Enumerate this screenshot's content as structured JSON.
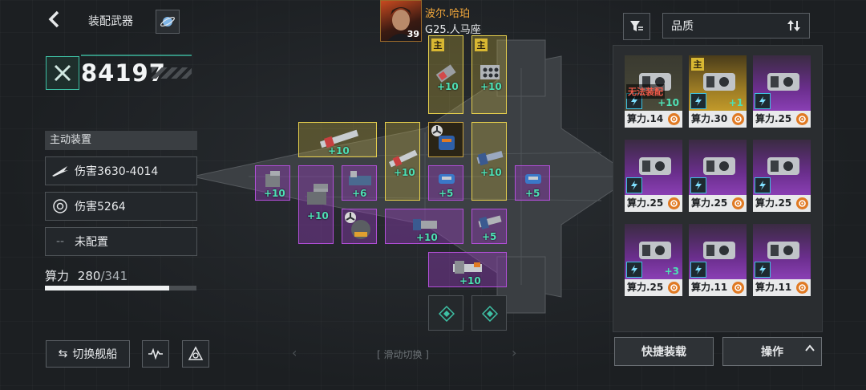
{
  "header": {
    "title": "装配武器"
  },
  "power": {
    "value": "84197"
  },
  "active_panel": {
    "title": "主动装置",
    "items": [
      {
        "label": "伤害3630-4014",
        "icon": "slash-damage-icon"
      },
      {
        "label": "伤害5264",
        "icon": "shield-burst-icon"
      },
      {
        "label": "未配置",
        "icon": "dash-icon",
        "prefix": "--"
      }
    ]
  },
  "compute": {
    "label": "算力",
    "used": "280",
    "max": "/341",
    "fraction": 0.821
  },
  "bottom_left": {
    "swap_label": "切换舰船"
  },
  "slide_hint": "[ 滑动切换 ]",
  "captain": {
    "name": "波尔.哈珀",
    "ship": "G25.人马座",
    "level": "39"
  },
  "slots": {
    "main_tag": "主",
    "levels": {
      "s1": "+10",
      "s2": "+10",
      "s3": "+10",
      "s4": "+10",
      "s5": "+10",
      "s6": "+10",
      "s7": "+10",
      "s8": "+6",
      "s9": "+5",
      "s10": "+5",
      "s11": "+10",
      "s12": "+10",
      "s13": "+5",
      "s14": "+10"
    }
  },
  "inventory": {
    "filter_icon": "filter-icon",
    "quality_label": "品质",
    "sort_icon": "sort-icon",
    "cards": [
      {
        "power": "算力.14",
        "rarity": "d",
        "plus": "+10",
        "warn": "无法装配"
      },
      {
        "power": "算力.30",
        "rarity": "g",
        "plus": "+1",
        "main": "主"
      },
      {
        "power": "算力.25",
        "rarity": "p"
      },
      {
        "power": "算力.25",
        "rarity": "p"
      },
      {
        "power": "算力.25",
        "rarity": "p"
      },
      {
        "power": "算力.25",
        "rarity": "p"
      },
      {
        "power": "算力.25",
        "rarity": "p",
        "plus": "+3"
      },
      {
        "power": "算力.11",
        "rarity": "p"
      },
      {
        "power": "算力.11",
        "rarity": "p"
      }
    ],
    "quick_label": "快捷装载",
    "op_label": "操作",
    "colors": {
      "purple": "#8a3fb4",
      "gold": "#c29a2a",
      "green": "#4ee0b5"
    }
  }
}
